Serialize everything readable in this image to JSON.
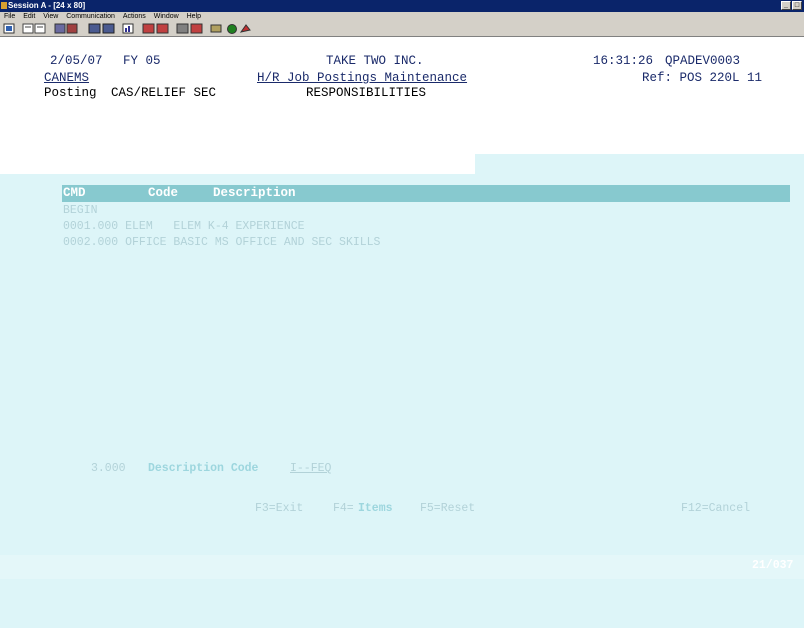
{
  "window": {
    "title": "Session A - [24 x 80]"
  },
  "menu": [
    "File",
    "Edit",
    "View",
    "Communication",
    "Actions",
    "Window",
    "Help"
  ],
  "screen": {
    "date": "2/05/07",
    "fy": "FY 05",
    "company": "TAKE TWO INC.",
    "time": "16:31:26",
    "device": "QPADEV0003",
    "program": "CANEMS",
    "screen_title": "H/R Job Postings Maintenance",
    "ref": "Ref: POS 220L 11",
    "posting_label": "Posting",
    "posting_value": "CAS/RELIEF SEC",
    "section": "RESPONSIBILITIES",
    "columns": {
      "cmd": "CMD",
      "code": "Code",
      "description": "Description"
    },
    "rows": [
      {
        "text": "BEGIN"
      },
      {
        "text": "0001.000 ELEM   ELEM K-4 EXPERIENCE"
      },
      {
        "text": "0002.000 OFFICE BASIC MS OFFICE AND SEC SKILLS"
      }
    ],
    "entry_seq": "3.000",
    "entry_label": "Description Code",
    "entry_value": "I--FEQ",
    "fkeys": {
      "f3": "F3=Exit",
      "f4_prefix": "F4=",
      "f4_highlight": "Items",
      "f5": "F5=Reset",
      "f12": "F12=Cancel"
    },
    "cursor_pos": "21/037"
  }
}
